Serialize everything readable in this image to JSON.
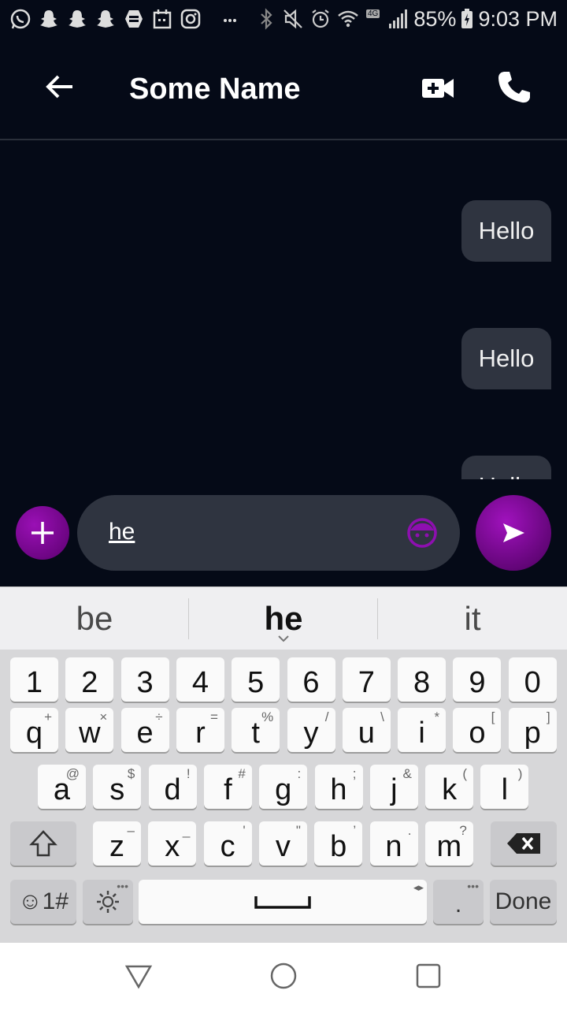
{
  "status_bar": {
    "battery": "85%",
    "time": "9:03 PM",
    "network": "4G",
    "notification_icons": [
      "whatsapp-icon",
      "snapchat-icon",
      "snapchat-icon",
      "snapchat-icon",
      "messenger-icon",
      "calendar-icon",
      "instagram-icon",
      "more-icon"
    ],
    "system_icons": [
      "bluetooth-icon",
      "mute-icon",
      "alarm-icon",
      "wifi-icon",
      "signal-icon",
      "battery-icon"
    ]
  },
  "header": {
    "contact_name": "Some Name",
    "icons": [
      "back-arrow-icon",
      "video-call-icon",
      "phone-icon"
    ]
  },
  "messages": [
    {
      "text": "Hello",
      "sender": "me"
    },
    {
      "text": "Hello",
      "sender": "me"
    },
    {
      "text": "Hello",
      "sender": "me"
    }
  ],
  "composer": {
    "input_value": "he",
    "icons": [
      "plus-icon",
      "emoji-face-icon",
      "send-icon"
    ]
  },
  "keyboard": {
    "suggestions": [
      "be",
      "he",
      "it"
    ],
    "number_row": [
      "1",
      "2",
      "3",
      "4",
      "5",
      "6",
      "7",
      "8",
      "9",
      "0"
    ],
    "row1": [
      {
        "key": "q",
        "hint": "+"
      },
      {
        "key": "w",
        "hint": "×"
      },
      {
        "key": "e",
        "hint": "÷"
      },
      {
        "key": "r",
        "hint": "="
      },
      {
        "key": "t",
        "hint": "%"
      },
      {
        "key": "y",
        "hint": "/"
      },
      {
        "key": "u",
        "hint": "\\"
      },
      {
        "key": "i",
        "hint": "*"
      },
      {
        "key": "o",
        "hint": "["
      },
      {
        "key": "p",
        "hint": "]"
      }
    ],
    "row2": [
      {
        "key": "a",
        "hint": "@"
      },
      {
        "key": "s",
        "hint": "$"
      },
      {
        "key": "d",
        "hint": "!"
      },
      {
        "key": "f",
        "hint": "#"
      },
      {
        "key": "g",
        "hint": ":"
      },
      {
        "key": "h",
        "hint": ";"
      },
      {
        "key": "j",
        "hint": "&"
      },
      {
        "key": "k",
        "hint": "("
      },
      {
        "key": "l",
        "hint": ")"
      }
    ],
    "row3": [
      {
        "key": "z",
        "hint": "–"
      },
      {
        "key": "x",
        "hint": "_"
      },
      {
        "key": "c",
        "hint": "'"
      },
      {
        "key": "v",
        "hint": "\""
      },
      {
        "key": "b",
        "hint": "’"
      },
      {
        "key": "n",
        "hint": "."
      },
      {
        "key": "m",
        "hint": "?"
      }
    ],
    "bottom_row": {
      "symbols_label": "☺1#",
      "period_label": ".",
      "done_label": "Done"
    },
    "icons": [
      "shift-icon",
      "backspace-icon",
      "settings-gear-icon",
      "space-bar-icon"
    ]
  },
  "nav_bar": {
    "icons": [
      "back-triangle-icon",
      "home-circle-icon",
      "recents-square-icon"
    ]
  },
  "colors": {
    "background": "#050a17",
    "bubble": "#2f3440",
    "accent": "#8e0fb0",
    "keyboard_bg": "#d7d7d9"
  }
}
